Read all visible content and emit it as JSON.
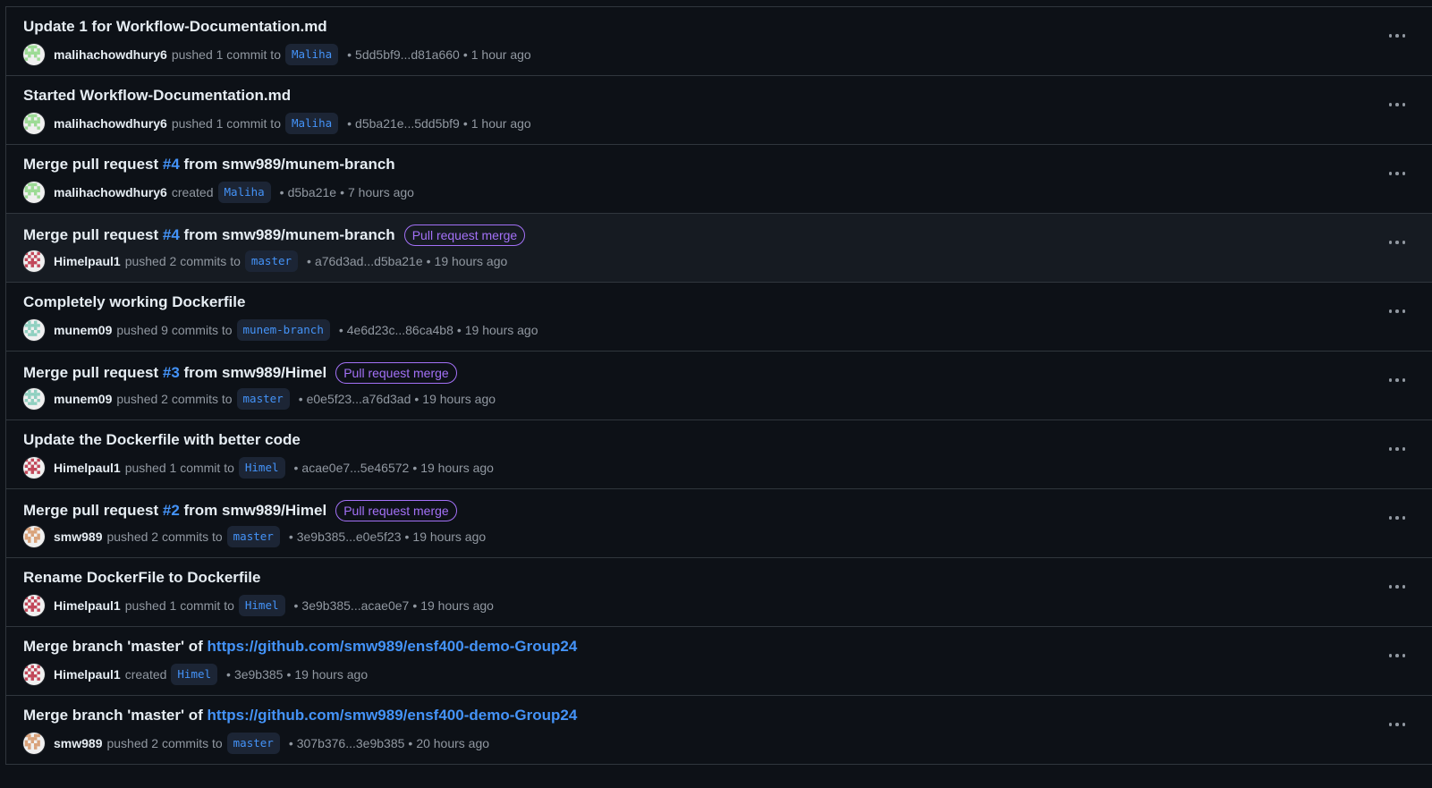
{
  "activity": [
    {
      "title": "Update 1 for Workflow-Documentation.md",
      "pr_number": null,
      "link_text": null,
      "title_suffix": null,
      "tag": null,
      "user": "malihachowdhury6",
      "avatar": "green",
      "action": "pushed 1 commit to",
      "branch": "Maliha",
      "commit_range": "5dd5bf9...d81a660",
      "time": "1 hour ago"
    },
    {
      "title": "Started Workflow-Documentation.md",
      "pr_number": null,
      "link_text": null,
      "title_suffix": null,
      "tag": null,
      "user": "malihachowdhury6",
      "avatar": "green",
      "action": "pushed 1 commit to",
      "branch": "Maliha",
      "commit_range": "d5ba21e...5dd5bf9",
      "time": "1 hour ago"
    },
    {
      "title": "Merge pull request ",
      "pr_number": "#4",
      "link_text": null,
      "title_suffix": " from smw989/munem-branch",
      "tag": null,
      "user": "malihachowdhury6",
      "avatar": "green",
      "action": "created",
      "branch": "Maliha",
      "commit_range": "d5ba21e",
      "time": "7 hours ago"
    },
    {
      "title": "Merge pull request ",
      "pr_number": "#4",
      "link_text": null,
      "title_suffix": " from smw989/munem-branch",
      "tag": "Pull request merge",
      "user": "Himelpaul1",
      "avatar": "red",
      "action": "pushed 2 commits to",
      "branch": "master",
      "commit_range": "a76d3ad...d5ba21e",
      "time": "19 hours ago"
    },
    {
      "title": "Completely working Dockerfile",
      "pr_number": null,
      "link_text": null,
      "title_suffix": null,
      "tag": null,
      "user": "munem09",
      "avatar": "teal",
      "action": "pushed 9 commits to",
      "branch": "munem-branch",
      "commit_range": "4e6d23c...86ca4b8",
      "time": "19 hours ago"
    },
    {
      "title": "Merge pull request ",
      "pr_number": "#3",
      "link_text": null,
      "title_suffix": " from smw989/Himel",
      "tag": "Pull request merge",
      "user": "munem09",
      "avatar": "teal",
      "action": "pushed 2 commits to",
      "branch": "master",
      "commit_range": "e0e5f23...a76d3ad",
      "time": "19 hours ago"
    },
    {
      "title": "Update the Dockerfile with better code",
      "pr_number": null,
      "link_text": null,
      "title_suffix": null,
      "tag": null,
      "user": "Himelpaul1",
      "avatar": "red",
      "action": "pushed 1 commit to",
      "branch": "Himel",
      "commit_range": "acae0e7...5e46572",
      "time": "19 hours ago"
    },
    {
      "title": "Merge pull request ",
      "pr_number": "#2",
      "link_text": null,
      "title_suffix": " from smw989/Himel",
      "tag": "Pull request merge",
      "user": "smw989",
      "avatar": "orange",
      "action": "pushed 2 commits to",
      "branch": "master",
      "commit_range": "3e9b385...e0e5f23",
      "time": "19 hours ago"
    },
    {
      "title": "Rename DockerFile to Dockerfile",
      "pr_number": null,
      "link_text": null,
      "title_suffix": null,
      "tag": null,
      "user": "Himelpaul1",
      "avatar": "red",
      "action": "pushed 1 commit to",
      "branch": "Himel",
      "commit_range": "3e9b385...acae0e7",
      "time": "19 hours ago"
    },
    {
      "title": "Merge branch 'master' of ",
      "pr_number": null,
      "link_text": "https://github.com/smw989/ensf400-demo-Group24",
      "title_suffix": null,
      "tag": null,
      "user": "Himelpaul1",
      "avatar": "red",
      "action": "created",
      "branch": "Himel",
      "commit_range": "3e9b385",
      "time": "19 hours ago"
    },
    {
      "title": "Merge branch 'master' of ",
      "pr_number": null,
      "link_text": "https://github.com/smw989/ensf400-demo-Group24",
      "title_suffix": null,
      "tag": null,
      "user": "smw989",
      "avatar": "orange",
      "action": "pushed 2 commits to",
      "branch": "master",
      "commit_range": "307b376...3e9b385",
      "time": "20 hours ago"
    }
  ],
  "separator": "•",
  "colors": {
    "background": "#0d1117",
    "border": "#30363d",
    "link": "#4493f8",
    "tag": "#a371f7",
    "muted": "#9198a1",
    "avatar_green": "#9cdb95",
    "avatar_red": "#c2485a",
    "avatar_teal": "#8fd0c0",
    "avatar_orange": "#d9a27a"
  }
}
